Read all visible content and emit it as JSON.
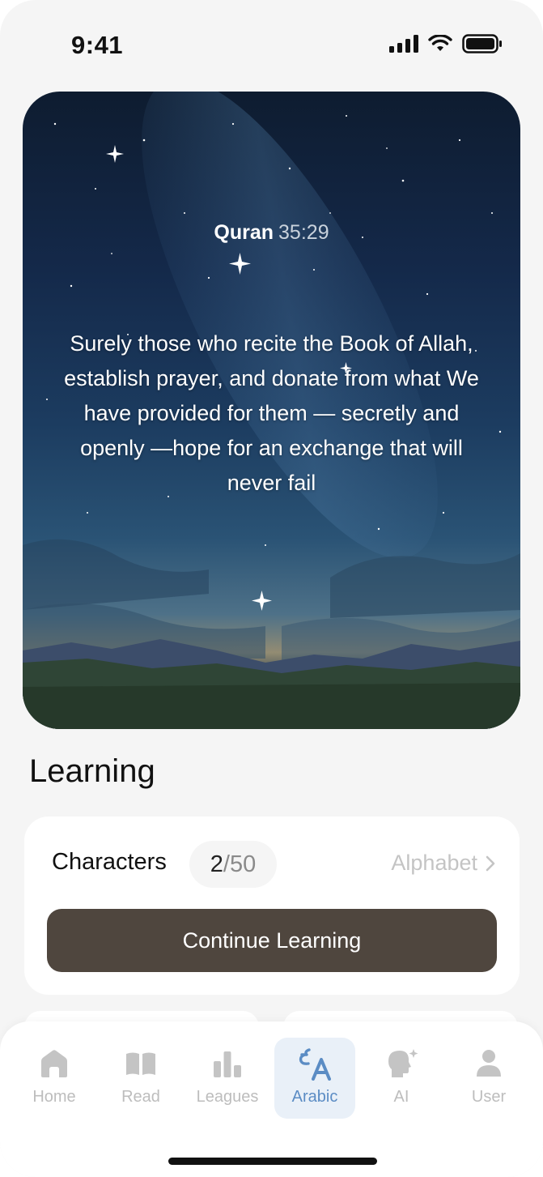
{
  "status_bar": {
    "time": "9:41"
  },
  "hero": {
    "ref_name": "Quran",
    "ref_number": "35:29",
    "quote": "Surely those who recite the Book of Allah, establish prayer, and donate from what We have provided for them — secretly and openly —hope for an exchange that will never fail"
  },
  "learning": {
    "title": "Learning",
    "card": {
      "label": "Characters",
      "progress_current": "2",
      "progress_total": "/50",
      "link_label": "Alphabet",
      "button_label": "Continue Learning"
    }
  },
  "tabbar": {
    "active": "arabic",
    "items": [
      {
        "id": "home",
        "label": "Home",
        "icon": "house-icon"
      },
      {
        "id": "read",
        "label": "Read",
        "icon": "book-icon"
      },
      {
        "id": "leagues",
        "label": "Leagues",
        "icon": "bar-chart-icon"
      },
      {
        "id": "arabic",
        "label": "Arabic",
        "icon": "translate-icon"
      },
      {
        "id": "ai",
        "label": "AI",
        "icon": "ai-head-icon"
      },
      {
        "id": "user",
        "label": "User",
        "icon": "person-icon"
      }
    ]
  },
  "colors": {
    "accent": "#5b8cc4",
    "button": "#4f463e",
    "inactive": "#bdbdbd"
  }
}
